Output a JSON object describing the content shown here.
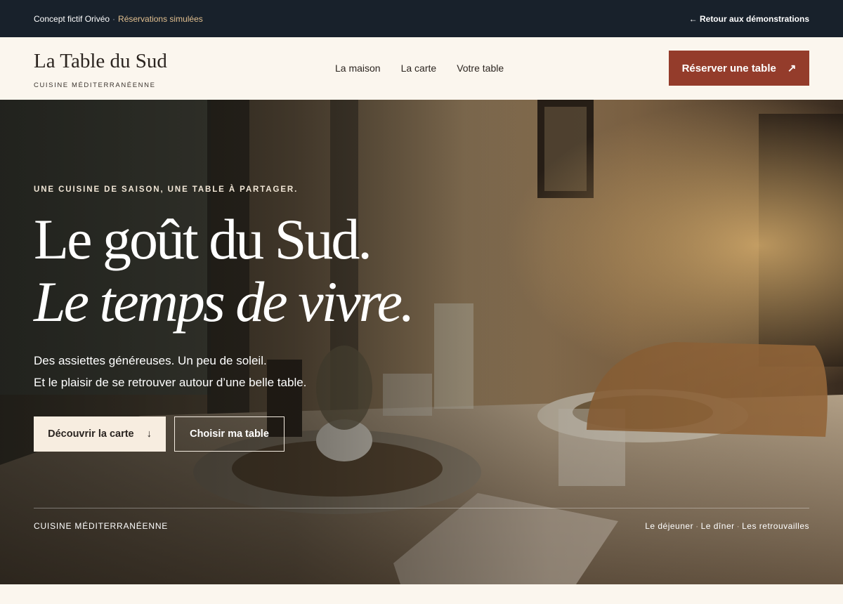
{
  "topbar": {
    "concept": "Concept fictif Orivéo",
    "separator": "·",
    "simulated": "Réservations simulées",
    "back_link": "← Retour aux démonstrations"
  },
  "header": {
    "brand_name": "La Table du Sud",
    "brand_tagline": "CUISINE MÉDITERRANÉENNE",
    "nav": [
      "La maison",
      "La carte",
      "Votre table"
    ],
    "cta_label": "Réserver une table",
    "cta_icon": "↗"
  },
  "hero": {
    "eyebrow": "UNE CUISINE DE SAISON, UNE TABLE À PARTAGER.",
    "headline_line1": "Le goût du Sud.",
    "headline_line2": "Le temps de vivre.",
    "lead_line1": "Des assiettes généreuses. Un peu de soleil.",
    "lead_line2": "Et le plaisir de se retrouver autour d’une belle table.",
    "primary_button": "Découvrir la carte",
    "primary_button_icon": "↓",
    "secondary_button": "Choisir ma table",
    "footer_left": "CUISINE MÉDITERRANÉENNE",
    "footer_right": [
      "Le déjeuner",
      "Le dîner",
      "Les retrouvailles"
    ],
    "footer_separator": "·"
  },
  "colors": {
    "topbar_bg": "#18212b",
    "accent": "#943c2b",
    "cream": "#fbf6ee",
    "gold": "#e1bf8f"
  }
}
